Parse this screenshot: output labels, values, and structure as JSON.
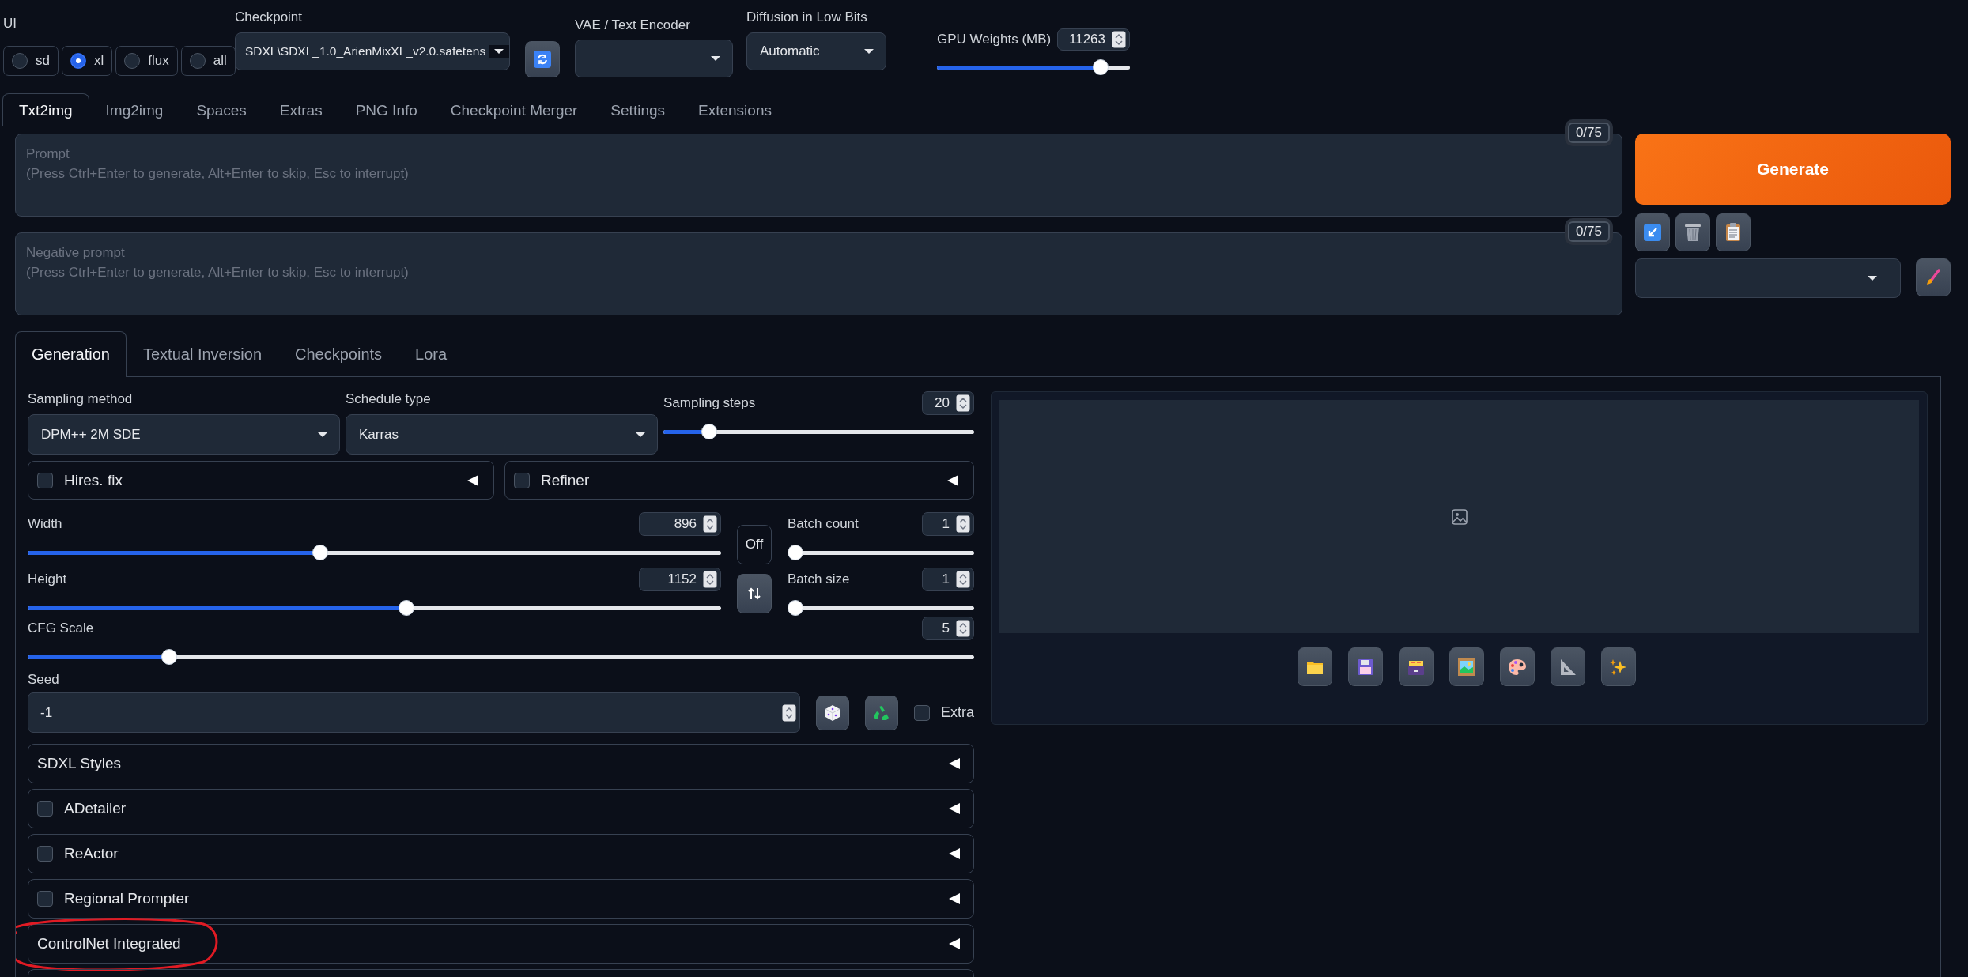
{
  "ui_selector": {
    "label": "UI",
    "options": [
      {
        "label": "sd",
        "selected": false
      },
      {
        "label": "xl",
        "selected": true
      },
      {
        "label": "flux",
        "selected": false
      },
      {
        "label": "all",
        "selected": false
      }
    ]
  },
  "checkpoint": {
    "label": "Checkpoint",
    "value": "SDXL\\SDXL_1.0_ArienMixXL_v2.0.safetens"
  },
  "vae": {
    "label": "VAE / Text Encoder"
  },
  "diffusion": {
    "label": "Diffusion in Low Bits",
    "value": "Automatic"
  },
  "gpu_weights": {
    "label": "GPU Weights (MB)",
    "value": "11263",
    "level": 0.88
  },
  "tabs": [
    {
      "label": "Txt2img",
      "selected": true
    },
    {
      "label": "Img2img",
      "selected": false
    },
    {
      "label": "Spaces",
      "selected": false
    },
    {
      "label": "Extras",
      "selected": false
    },
    {
      "label": "PNG Info",
      "selected": false
    },
    {
      "label": "Checkpoint Merger",
      "selected": false
    },
    {
      "label": "Settings",
      "selected": false
    },
    {
      "label": "Extensions",
      "selected": false
    }
  ],
  "prompt": {
    "placeholder": "Prompt\n(Press Ctrl+Enter to generate, Alt+Enter to skip, Esc to interrupt)",
    "token_count": "0/75"
  },
  "negative_prompt": {
    "placeholder": "Negative prompt\n(Press Ctrl+Enter to generate, Alt+Enter to skip, Esc to interrupt)",
    "token_count": "0/75"
  },
  "generate_button": "Generate",
  "sub_tabs": [
    {
      "label": "Generation",
      "selected": true
    },
    {
      "label": "Textual Inversion",
      "selected": false
    },
    {
      "label": "Checkpoints",
      "selected": false
    },
    {
      "label": "Lora",
      "selected": false
    }
  ],
  "sampling_method": {
    "label": "Sampling method",
    "value": "DPM++ 2M SDE"
  },
  "schedule_type": {
    "label": "Schedule type",
    "value": "Karras"
  },
  "sampling_steps": {
    "label": "Sampling steps",
    "value": "20",
    "level": 0.13
  },
  "hires_fix": {
    "label": "Hires. fix",
    "checked": false
  },
  "refiner": {
    "label": "Refiner",
    "checked": false
  },
  "width": {
    "label": "Width",
    "value": "896",
    "level": 0.42
  },
  "height": {
    "label": "Height",
    "value": "1152",
    "level": 0.547
  },
  "resolution_toggle": "Off",
  "batch_count": {
    "label": "Batch count",
    "value": "1",
    "level": 0
  },
  "batch_size": {
    "label": "Batch size",
    "value": "1",
    "level": 0
  },
  "cfg_scale": {
    "label": "CFG Scale",
    "value": "5",
    "level": 0.144
  },
  "seed": {
    "label": "Seed",
    "value": "-1"
  },
  "extra": {
    "label": "Extra",
    "checked": false
  },
  "accordions": [
    {
      "label": "SDXL Styles",
      "kind": "plain"
    },
    {
      "label": "ADetailer",
      "kind": "checkbox",
      "checked": false
    },
    {
      "label": "ReActor",
      "kind": "checkbox",
      "checked": false
    },
    {
      "label": "Regional Prompter",
      "kind": "checkbox",
      "checked": false
    },
    {
      "label": "ControlNet Integrated",
      "kind": "plain"
    }
  ]
}
